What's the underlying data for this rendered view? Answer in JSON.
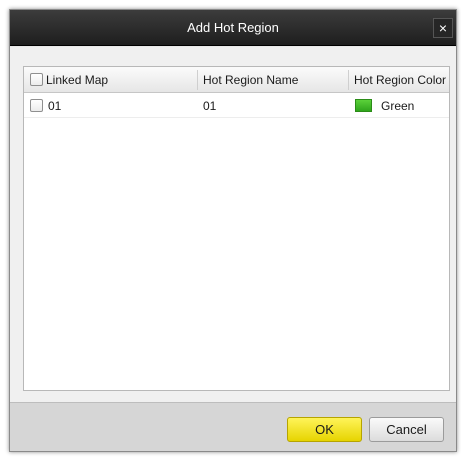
{
  "dialog": {
    "title": "Add Hot Region",
    "close_label": "×"
  },
  "table": {
    "columns": [
      "Linked Map",
      "Hot Region Name",
      "Hot Region Color"
    ],
    "rows": [
      {
        "linked_map": "01",
        "name": "01",
        "color_name": "Green",
        "color_hex": "#3cbf26",
        "checked": false
      }
    ]
  },
  "buttons": {
    "ok": "OK",
    "cancel": "Cancel"
  },
  "colors": {
    "title_bar": "#2a2a2a",
    "ok_button": "#f2e20f",
    "swatch_green": "#3cbf26"
  }
}
